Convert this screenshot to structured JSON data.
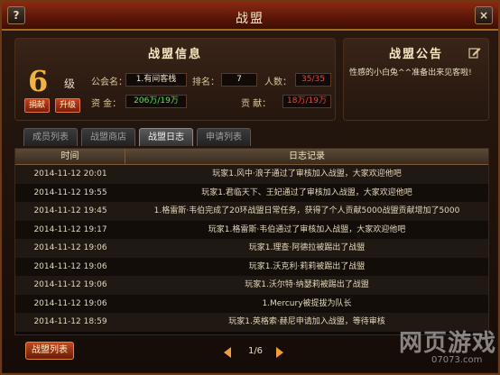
{
  "window": {
    "title": "战盟",
    "help": "?",
    "close": "×"
  },
  "info": {
    "title": "战盟信息",
    "level": "6",
    "level_unit": "级",
    "donate_label": "捐献",
    "upgrade_label": "升级",
    "guild_name_label": "公会名：",
    "guild_name": "1.有间客栈",
    "rank_label": "排名：",
    "rank": "7",
    "people_label": "人数：",
    "people": "35/35",
    "funds_label": "资  金：",
    "funds": "206万/19万",
    "contrib_label": "贡  献：",
    "contrib": "18万/19万"
  },
  "notice": {
    "title": "战盟公告",
    "text": "性感的小白兔^^准备出来见客啦!",
    "edit_icon": "edit-icon"
  },
  "tabs": [
    {
      "label": "成员列表",
      "active": false
    },
    {
      "label": "战盟商店",
      "active": false
    },
    {
      "label": "战盟日志",
      "active": true
    },
    {
      "label": "申请列表",
      "active": false
    }
  ],
  "log": {
    "col_time": "时间",
    "col_log": "日志记录",
    "rows": [
      {
        "time": "2014-11-12 20:01",
        "text": "玩家1.风中·浪子通过了审核加入战盟，大家欢迎他吧"
      },
      {
        "time": "2014-11-12 19:55",
        "text": "玩家1.君临天下、王妃通过了审核加入战盟，大家欢迎他吧"
      },
      {
        "time": "2014-11-12 19:45",
        "text": "1.格雷斯·韦伯完成了20环战盟日常任务，获得了个人贡献5000战盟贡献增加了5000"
      },
      {
        "time": "2014-11-12 19:17",
        "text": "玩家1.格雷斯·韦伯通过了审核加入战盟，大家欢迎他吧"
      },
      {
        "time": "2014-11-12 19:06",
        "text": "玩家1.理查·阿德拉被踢出了战盟"
      },
      {
        "time": "2014-11-12 19:06",
        "text": "玩家1.沃克利·莉莉被踢出了战盟"
      },
      {
        "time": "2014-11-12 19:06",
        "text": "玩家1.沃尔特·纳瑟莉被踢出了战盟"
      },
      {
        "time": "2014-11-12 19:06",
        "text": "1.Mercury被提拔为队长"
      },
      {
        "time": "2014-11-12 18:59",
        "text": "玩家1.英格索·赫尼申请加入战盟，等待审核"
      }
    ]
  },
  "footer": {
    "list_label": "战盟列表",
    "page": "1/6"
  },
  "watermark": {
    "text": "网页游戏",
    "url": "07073.com"
  }
}
